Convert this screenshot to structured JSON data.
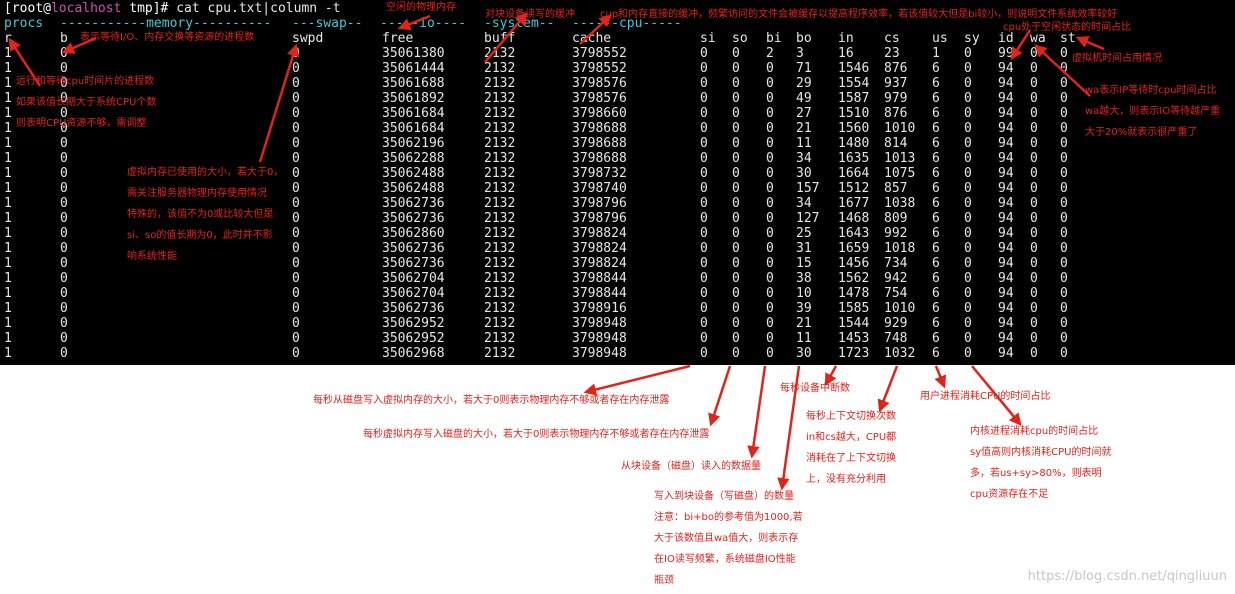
{
  "terminal": {
    "prompt": {
      "open": "[",
      "user": "root",
      "at": "@",
      "host": "localhost",
      "dir": " tmp]# ",
      "command": "cat cpu.txt|column -t"
    },
    "group_header": {
      "procs": "procs",
      "memory": "-----------memory----------",
      "swap": "---swap--",
      "io": "-----io----",
      "system": "-system--",
      "cpu": "------cpu-----"
    },
    "columns": [
      "r",
      "b",
      "swpd",
      "free",
      "buff",
      "cache",
      "si",
      "so",
      "bi",
      "bo",
      "in",
      "cs",
      "us",
      "sy",
      "id",
      "wa",
      "st"
    ],
    "rows": [
      [
        "1",
        "0",
        "0",
        "35061380",
        "2132",
        "3798552",
        "0",
        "0",
        "2",
        "3",
        "16",
        "23",
        "1",
        "0",
        "99",
        "0",
        "0"
      ],
      [
        "1",
        "0",
        "0",
        "35061444",
        "2132",
        "3798552",
        "0",
        "0",
        "0",
        "71",
        "1546",
        "876",
        "6",
        "0",
        "94",
        "0",
        "0"
      ],
      [
        "1",
        "0",
        "0",
        "35061688",
        "2132",
        "3798576",
        "0",
        "0",
        "0",
        "29",
        "1554",
        "937",
        "6",
        "0",
        "94",
        "0",
        "0"
      ],
      [
        "1",
        "0",
        "0",
        "35061892",
        "2132",
        "3798576",
        "0",
        "0",
        "0",
        "49",
        "1587",
        "979",
        "6",
        "0",
        "94",
        "0",
        "0"
      ],
      [
        "1",
        "0",
        "0",
        "35061684",
        "2132",
        "3798660",
        "0",
        "0",
        "0",
        "27",
        "1510",
        "876",
        "6",
        "0",
        "94",
        "0",
        "0"
      ],
      [
        "1",
        "0",
        "0",
        "35061684",
        "2132",
        "3798688",
        "0",
        "0",
        "0",
        "21",
        "1560",
        "1010",
        "6",
        "0",
        "94",
        "0",
        "0"
      ],
      [
        "1",
        "0",
        "0",
        "35062196",
        "2132",
        "3798688",
        "0",
        "0",
        "0",
        "11",
        "1480",
        "814",
        "6",
        "0",
        "94",
        "0",
        "0"
      ],
      [
        "1",
        "0",
        "0",
        "35062288",
        "2132",
        "3798688",
        "0",
        "0",
        "0",
        "34",
        "1635",
        "1013",
        "6",
        "0",
        "94",
        "0",
        "0"
      ],
      [
        "1",
        "0",
        "0",
        "35062488",
        "2132",
        "3798732",
        "0",
        "0",
        "0",
        "30",
        "1664",
        "1075",
        "6",
        "0",
        "94",
        "0",
        "0"
      ],
      [
        "1",
        "0",
        "0",
        "35062488",
        "2132",
        "3798740",
        "0",
        "0",
        "0",
        "157",
        "1512",
        "857",
        "6",
        "0",
        "94",
        "0",
        "0"
      ],
      [
        "1",
        "0",
        "0",
        "35062736",
        "2132",
        "3798796",
        "0",
        "0",
        "0",
        "34",
        "1677",
        "1038",
        "6",
        "0",
        "94",
        "0",
        "0"
      ],
      [
        "1",
        "0",
        "0",
        "35062736",
        "2132",
        "3798796",
        "0",
        "0",
        "0",
        "127",
        "1468",
        "809",
        "6",
        "0",
        "94",
        "0",
        "0"
      ],
      [
        "1",
        "0",
        "0",
        "35062860",
        "2132",
        "3798824",
        "0",
        "0",
        "0",
        "25",
        "1643",
        "992",
        "6",
        "0",
        "94",
        "0",
        "0"
      ],
      [
        "1",
        "0",
        "0",
        "35062736",
        "2132",
        "3798824",
        "0",
        "0",
        "0",
        "31",
        "1659",
        "1018",
        "6",
        "0",
        "94",
        "0",
        "0"
      ],
      [
        "1",
        "0",
        "0",
        "35062736",
        "2132",
        "3798824",
        "0",
        "0",
        "0",
        "15",
        "1456",
        "734",
        "6",
        "0",
        "94",
        "0",
        "0"
      ],
      [
        "1",
        "0",
        "0",
        "35062704",
        "2132",
        "3798844",
        "0",
        "0",
        "0",
        "38",
        "1562",
        "942",
        "6",
        "0",
        "94",
        "0",
        "0"
      ],
      [
        "1",
        "0",
        "0",
        "35062704",
        "2132",
        "3798844",
        "0",
        "0",
        "0",
        "10",
        "1478",
        "754",
        "6",
        "0",
        "94",
        "0",
        "0"
      ],
      [
        "1",
        "0",
        "0",
        "35062736",
        "2132",
        "3798916",
        "0",
        "0",
        "0",
        "39",
        "1585",
        "1010",
        "6",
        "0",
        "94",
        "0",
        "0"
      ],
      [
        "1",
        "0",
        "0",
        "35062952",
        "2132",
        "3798948",
        "0",
        "0",
        "0",
        "21",
        "1544",
        "929",
        "6",
        "0",
        "94",
        "0",
        "0"
      ],
      [
        "1",
        "0",
        "0",
        "35062952",
        "2132",
        "3798948",
        "0",
        "0",
        "0",
        "11",
        "1453",
        "748",
        "6",
        "0",
        "94",
        "0",
        "0"
      ],
      [
        "1",
        "0",
        "0",
        "35062968",
        "2132",
        "3798948",
        "0",
        "0",
        "0",
        "30",
        "1723",
        "1032",
        "6",
        "0",
        "94",
        "0",
        "0"
      ]
    ]
  },
  "annotations": {
    "free_top": "空闲的物理内存",
    "buff_top": "对块设备读写的缓冲",
    "cache_top": "cup和内存直接的缓冲，频繁访问的文件会被缓存以提高程序效率，若该值较大但是bi较小，则说明文件系统效率较好",
    "id_top": "cpu处于空闲状态的时间占比",
    "st_side": "虚拟机时间占用情况",
    "b_note": "表示等待I/O、内存交换等资源的进程数",
    "r_note": "运行和等待cpu时间片的进程数\n如果该值长期大于系统CPU个数\n则表明CPU资源不够，需调整",
    "swpd_note": "虚拟内存已使用的大小，若大于0，\n需关注服务器物理内存使用情况\n特殊的，该值不为0或比较大但是\nsi、so的值长期为0，此时并不影\n响系统性能",
    "wa_note": "wa表示IP等待时cpu时间占比\nwa越大，则表示IO等待越严重\n大于20%就表示很严重了",
    "si_note": "每秒从磁盘写入虚拟内存的大小，若大于0则表示物理内存不够或者存在内存泄露",
    "so_note": "每秒虚拟内存写入磁盘的大小，若大于0则表示物理内存不够或者存在内存泄露",
    "bi_note": "从块设备（磁盘）读入的数据量",
    "bo_note": "写入到块设备（写磁盘）的数量\n注意：bi+bo的参考值为1000,若\n大于该数值且wa值大，则表示存\n在IO读写频繁，系统磁盘IO性能\n瓶颈",
    "in_note": "每秒设备中断数",
    "cs_note": "每秒上下文切换次数\nin和cs越大，CPU都\n消耗在了上下文切换\n上，没有充分利用",
    "us_note": "用户进程消耗CPU的时间占比",
    "sy_note": "内核进程消耗cpu的时间占比\nsy值高则内核消耗CPU的时间就\n多，若us+sy>80%，则表明\ncpu资源存在不足"
  },
  "watermark": "https://blog.csdn.net/qingliuun",
  "colors": {
    "terminal_bg": "#000000",
    "text": "#e6e6e6",
    "header_cyan": "#3fc9d6",
    "host_magenta": "#d04fb0",
    "annotation_red": "#e2231a"
  }
}
